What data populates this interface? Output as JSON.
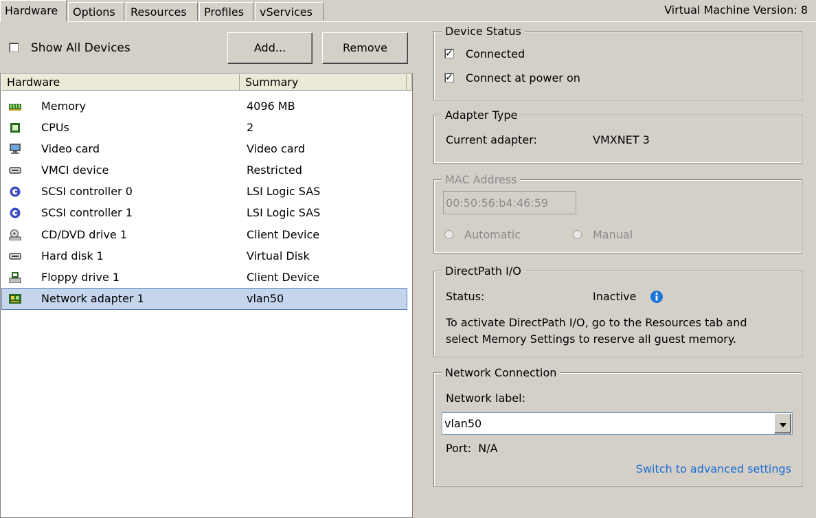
{
  "tabs": [
    "Hardware",
    "Options",
    "Resources",
    "Profiles",
    "vServices"
  ],
  "vm_version": "Virtual Machine Version: 8",
  "show_all_devices_label": "Show All Devices",
  "add_button": "Add...",
  "remove_button": "Remove",
  "list": {
    "col_hardware": "Hardware",
    "col_summary": "Summary",
    "rows": [
      {
        "name": "Memory",
        "summary": "4096 MB",
        "icon": "memory-icon"
      },
      {
        "name": "CPUs",
        "summary": "2",
        "icon": "cpu-icon"
      },
      {
        "name": "Video card",
        "summary": "Video card",
        "icon": "monitor-icon"
      },
      {
        "name": "VMCI device",
        "summary": "Restricted",
        "icon": "device-icon"
      },
      {
        "name": "SCSI controller 0",
        "summary": "LSI Logic SAS",
        "icon": "scsi-icon"
      },
      {
        "name": "SCSI controller 1",
        "summary": "LSI Logic SAS",
        "icon": "scsi-icon"
      },
      {
        "name": "CD/DVD drive 1",
        "summary": "Client Device",
        "icon": "cd-drive-icon"
      },
      {
        "name": "Hard disk 1",
        "summary": "Virtual Disk",
        "icon": "hard-disk-icon"
      },
      {
        "name": "Floppy drive 1",
        "summary": "Client Device",
        "icon": "floppy-icon"
      },
      {
        "name": "Network adapter 1",
        "summary": "vlan50",
        "icon": "network-card-icon",
        "selected": true
      }
    ]
  },
  "device_status": {
    "title": "Device Status",
    "connected": "Connected",
    "connect_power_on": "Connect at power on",
    "connected_checked": true,
    "power_on_checked": true
  },
  "adapter_type": {
    "title": "Adapter Type",
    "label": "Current adapter:",
    "value": "VMXNET 3"
  },
  "mac_address": {
    "title": "MAC Address",
    "value": "00:50:56:b4:46:59",
    "automatic": "Automatic",
    "manual": "Manual"
  },
  "directpath": {
    "title": "DirectPath I/O",
    "status_label": "Status:",
    "status_value": "Inactive",
    "note_line1": "To activate DirectPath I/O, go to the Resources tab and",
    "note_line2": "select Memory Settings to reserve all guest memory."
  },
  "network_connection": {
    "title": "Network Connection",
    "label": "Network label:",
    "selected": "vlan50",
    "port": "Port:  N/A",
    "advanced_link": "Switch to advanced settings"
  },
  "colors": {
    "selection": "#c4d5ec",
    "link": "#1c6bd6",
    "info": "#1e74d8"
  }
}
